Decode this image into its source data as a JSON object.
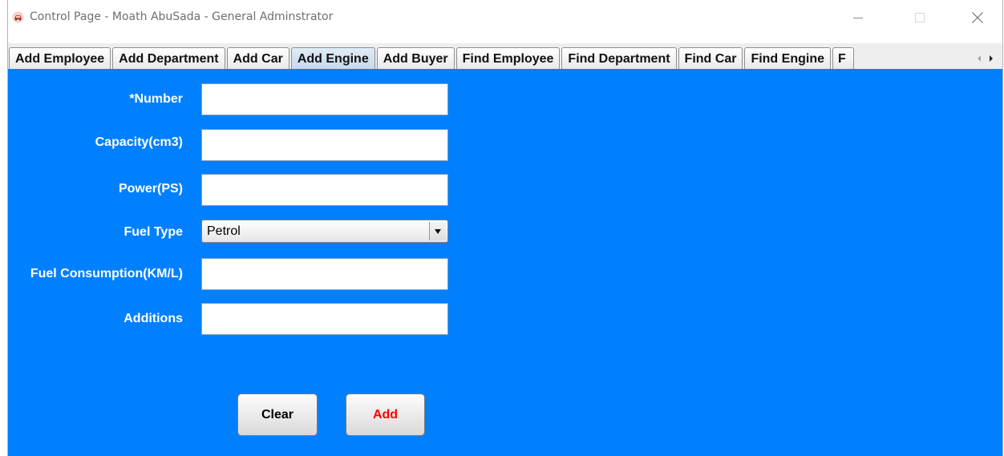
{
  "window": {
    "title": "Control Page - Moath AbuSada - General Adminstrator"
  },
  "tabs": [
    {
      "label": "Add Employee",
      "selected": false
    },
    {
      "label": "Add Department",
      "selected": false
    },
    {
      "label": "Add Car",
      "selected": false
    },
    {
      "label": "Add Engine",
      "selected": true
    },
    {
      "label": "Add Buyer",
      "selected": false
    },
    {
      "label": "Find Employee",
      "selected": false
    },
    {
      "label": "Find Department",
      "selected": false
    },
    {
      "label": "Find Car",
      "selected": false
    },
    {
      "label": "Find Engine",
      "selected": false
    },
    {
      "label": "F",
      "selected": false
    }
  ],
  "form": {
    "number_label": "*Number",
    "number_value": "",
    "capacity_label": "Capacity(cm3)",
    "capacity_value": "",
    "power_label": "Power(PS)",
    "power_value": "",
    "fuel_type_label": "Fuel Type",
    "fuel_type_value": "Petrol",
    "fuel_consumption_label": "Fuel Consumption(KM/L)",
    "fuel_consumption_value": "",
    "additions_label": "Additions",
    "additions_value": ""
  },
  "buttons": {
    "clear_label": "Clear",
    "add_label": "Add"
  },
  "colors": {
    "content_background": "#0080ff",
    "add_text": "#ff0000"
  }
}
